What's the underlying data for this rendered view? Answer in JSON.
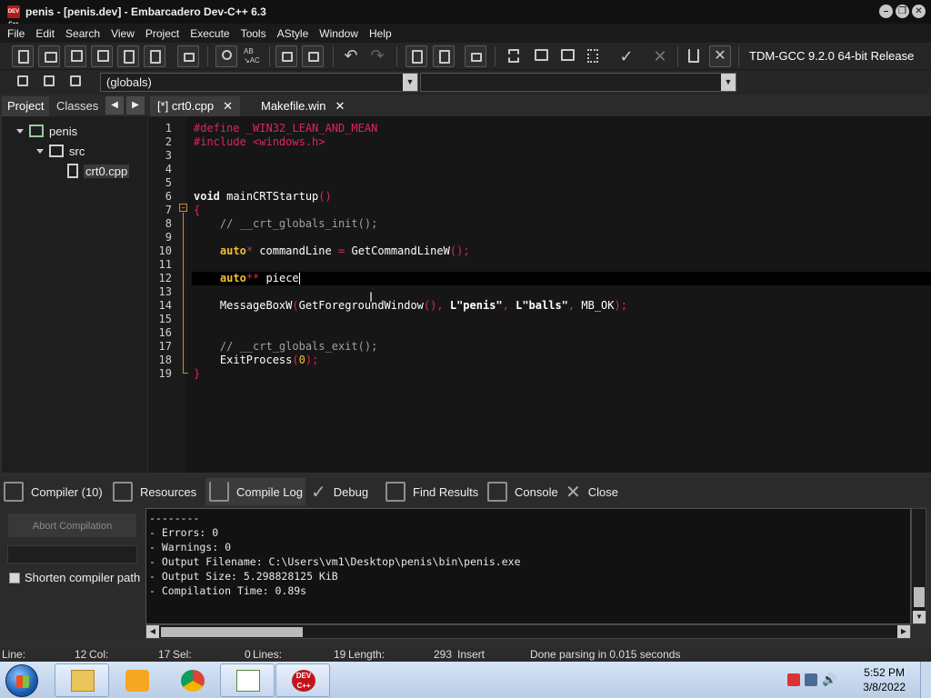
{
  "window": {
    "title": "penis - [penis.dev] - Embarcadero Dev-C++ 6.3",
    "app_icon_text": "DEV C++",
    "controls": [
      "minimize",
      "restore",
      "close"
    ]
  },
  "menu": [
    "File",
    "Edit",
    "Search",
    "View",
    "Project",
    "Execute",
    "Tools",
    "AStyle",
    "Window",
    "Help"
  ],
  "toolbar": {
    "compiler": "TDM-GCC 9.2.0 64-bit Release",
    "scope_combo": "(globals)",
    "icons": [
      "new-file-icon",
      "open-icon",
      "save-icon",
      "save-all-icon",
      "close-file-icon",
      "close-all-icon",
      "print-icon",
      "find-icon",
      "replace-icon",
      "indent-icon",
      "unindent-icon",
      "undo-icon",
      "redo-icon",
      "new-class-icon",
      "new-member-icon",
      "insert-icon",
      "compile-icon",
      "run-icon",
      "compile-run-icon",
      "rebuild-icon",
      "check-icon",
      "stop-icon",
      "chart-icon",
      "delete-icon"
    ]
  },
  "left_panel": {
    "tabs": [
      "Project",
      "Classes"
    ],
    "active_tab": "Project",
    "tree": [
      {
        "label": "penis",
        "level": 0,
        "type": "project"
      },
      {
        "label": "src",
        "level": 1,
        "type": "folder"
      },
      {
        "label": "crt0.cpp",
        "level": 2,
        "type": "file",
        "selected": true
      }
    ]
  },
  "editor": {
    "tabs": [
      {
        "label": "[*] crt0.cpp",
        "active": true
      },
      {
        "label": "Makefile.win",
        "active": false
      }
    ],
    "current_line": 12,
    "lines": [
      {
        "n": "1",
        "text": "#define _WIN32_LEAN_AND_MEAN"
      },
      {
        "n": "2",
        "text": "#include <windows.h>"
      },
      {
        "n": "3",
        "text": ""
      },
      {
        "n": "4",
        "text": ""
      },
      {
        "n": "5",
        "text": ""
      },
      {
        "n": "6",
        "text": "void mainCRTStartup()"
      },
      {
        "n": "7",
        "text": "{"
      },
      {
        "n": "8",
        "text": "    // __crt_globals_init();"
      },
      {
        "n": "9",
        "text": ""
      },
      {
        "n": "10",
        "text": "    auto* commandLine = GetCommandLineW();"
      },
      {
        "n": "11",
        "text": ""
      },
      {
        "n": "12",
        "text": "    auto** piece"
      },
      {
        "n": "13",
        "text": ""
      },
      {
        "n": "14",
        "text": "    MessageBoxW(GetForegroundWindow(), L\"penis\", L\"balls\", MB_OK);"
      },
      {
        "n": "15",
        "text": ""
      },
      {
        "n": "16",
        "text": ""
      },
      {
        "n": "17",
        "text": "    // __crt_globals_exit();"
      },
      {
        "n": "18",
        "text": "    ExitProcess(0);"
      },
      {
        "n": "19",
        "text": "}"
      }
    ]
  },
  "bottom_tabs": [
    {
      "label": "Compiler (10)",
      "icon": "grid-icon"
    },
    {
      "label": "Resources",
      "icon": "resources-icon"
    },
    {
      "label": "Compile Log",
      "icon": "chart-icon",
      "active": true
    },
    {
      "label": "Debug",
      "icon": "check-icon"
    },
    {
      "label": "Find Results",
      "icon": "find-icon"
    },
    {
      "label": "Console",
      "icon": "console-icon"
    },
    {
      "label": "Close",
      "icon": "close-icon"
    }
  ],
  "compile_panel": {
    "abort_label": "Abort Compilation",
    "shorten_label": "Shorten compiler path",
    "shorten_checked": false,
    "log": [
      "--------",
      "- Errors: 0",
      "- Warnings: 0",
      "- Output Filename: C:\\Users\\vm1\\Desktop\\penis\\bin\\penis.exe",
      "- Output Size: 5.298828125 KiB",
      "- Compilation Time: 0.89s"
    ]
  },
  "status": {
    "line": "Line:",
    "line_val": "12",
    "col": "Col:",
    "col_val": "17",
    "sel": "Sel:",
    "sel_val": "0",
    "lines": "Lines:",
    "lines_val": "19",
    "length": "Length:",
    "length_val": "293",
    "mode": "Insert",
    "message": "Done parsing in 0.015 seconds"
  },
  "taskbar": {
    "apps": [
      "explorer-icon",
      "media-player-icon",
      "chrome-icon",
      "notepad-icon",
      "devcpp-icon"
    ],
    "devcpp_text": "DEV C++",
    "time": "5:52 PM",
    "date": "3/8/2022"
  },
  "colors": {
    "preprocessor": "#e0245e",
    "keyword": "#f0c030",
    "comment": "#a0a0a0",
    "background": "#161616"
  }
}
